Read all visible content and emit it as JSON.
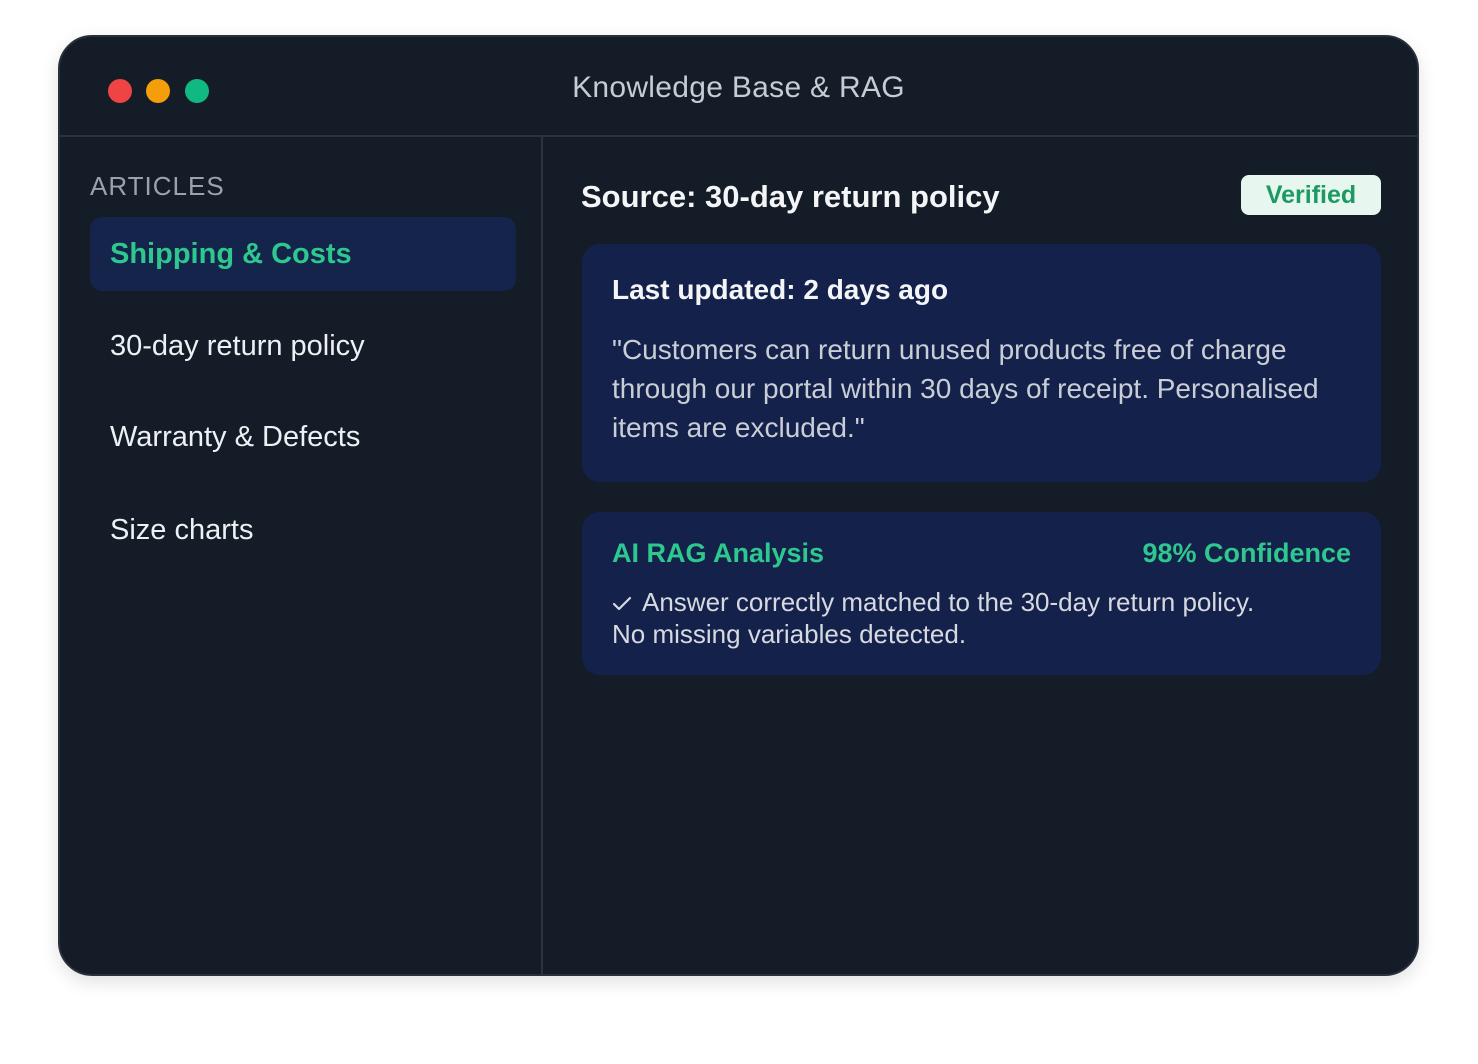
{
  "window": {
    "title": "Knowledge Base & RAG",
    "controls": {
      "close_color": "#ef4444",
      "minimize_color": "#f59e0b",
      "zoom_color": "#10b981"
    }
  },
  "sidebar": {
    "heading": "ARTICLES",
    "items": [
      {
        "label": "Shipping & Costs",
        "active": true
      },
      {
        "label": "30-day return policy",
        "active": false
      },
      {
        "label": "Warranty & Defects",
        "active": false
      },
      {
        "label": "Size charts",
        "active": false
      }
    ]
  },
  "main": {
    "source_title": "Source: 30-day return policy",
    "badge": "Verified",
    "source_card": {
      "last_updated": "Last updated: 2 days ago",
      "quote": "\"Customers can return unused products free of charge through our portal within 30 days of receipt. Personalised items are excluded.\""
    },
    "analysis_card": {
      "title": "AI RAG Analysis",
      "confidence": "98% Confidence",
      "check_icon": "checkmark-icon",
      "line1": "Answer correctly matched to the 30-day return policy.",
      "line2": "No missing variables detected."
    }
  },
  "colors": {
    "accent_green": "#2ec88f",
    "window_bg": "#131c27",
    "card_bg": "#14214a"
  }
}
